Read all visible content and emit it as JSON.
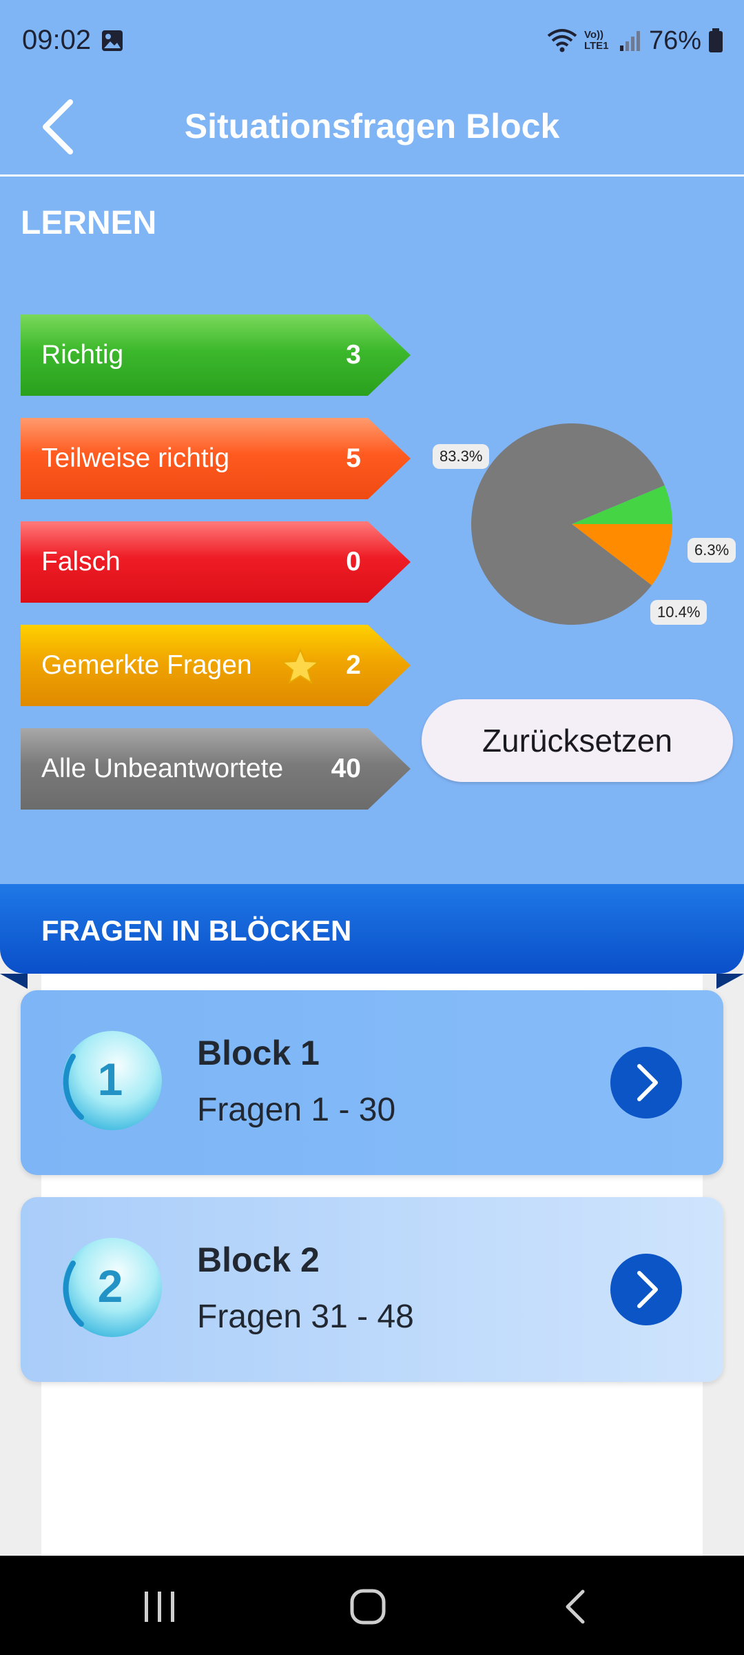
{
  "status_bar": {
    "time": "09:02",
    "battery": "76%",
    "network": "Vo)) LTE1"
  },
  "app_bar": {
    "title": "Situationsfragen Block"
  },
  "learn_section": {
    "title": "LERNEN",
    "stats": [
      {
        "label": "Richtig",
        "value": "3",
        "color": "#3cb82c"
      },
      {
        "label": "Teilweise richtig",
        "value": "5",
        "color": "#ff5a1f"
      },
      {
        "label": "Falsch",
        "value": "0",
        "color": "#ee1c25"
      },
      {
        "label": "Gemerkte Fragen",
        "value": "2",
        "color": "#f0a500"
      },
      {
        "label": "Alle Unbeantwortete",
        "value": "40",
        "color": "#7a7a7a"
      }
    ],
    "reset_label": "Zurücksetzen"
  },
  "chart_data": {
    "type": "pie",
    "slices": [
      {
        "label": "83.3%",
        "value": 83.3,
        "color": "#7a7a7a"
      },
      {
        "label": "6.3%",
        "value": 6.3,
        "color": "#44d444"
      },
      {
        "label": "10.4%",
        "value": 10.4,
        "color": "#ff8c00"
      }
    ]
  },
  "blocks_section": {
    "title": "FRAGEN IN BLÖCKEN",
    "blocks": [
      {
        "number": "1",
        "title": "Block 1",
        "subtitle": "Fragen 1 - 30"
      },
      {
        "number": "2",
        "title": "Block 2",
        "subtitle": "Fragen 31 - 48"
      }
    ]
  },
  "icons": {
    "back": "chevron-left-icon",
    "gallery": "image-icon",
    "wifi": "wifi-icon",
    "signal": "signal-icon",
    "battery": "battery-icon",
    "star": "star-icon",
    "go": "chevron-right-icon",
    "nav_recent": "recent-apps-icon",
    "nav_home": "home-icon",
    "nav_back": "nav-back-icon"
  }
}
